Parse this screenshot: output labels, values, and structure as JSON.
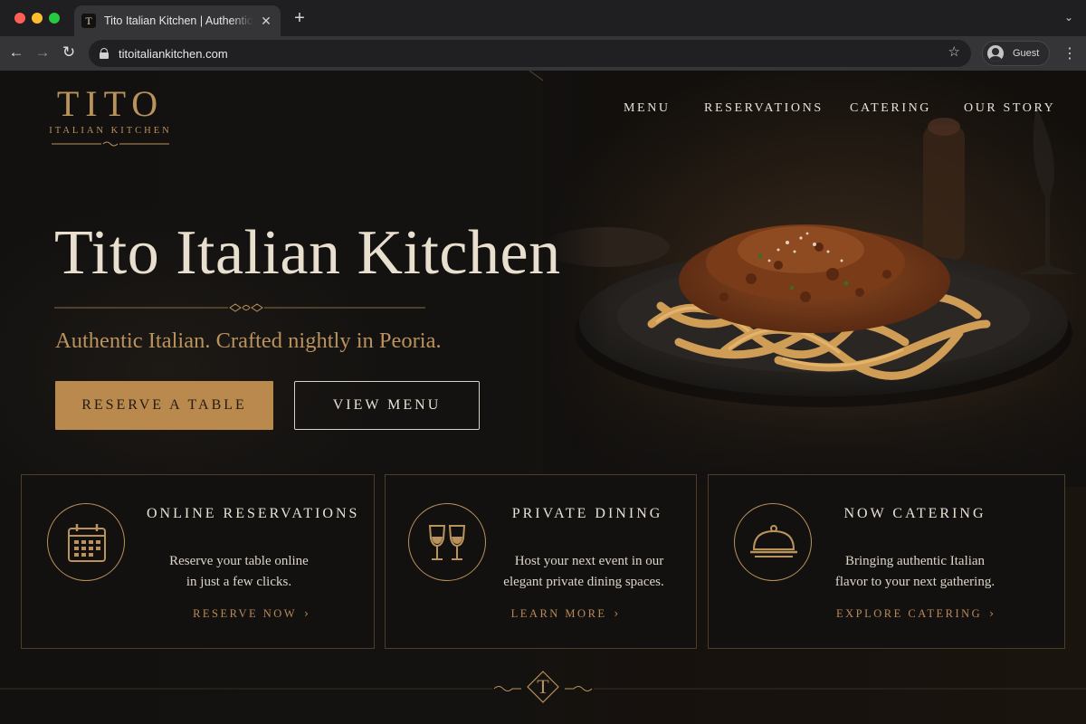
{
  "browser": {
    "tab_title": "Tito Italian Kitchen | Authentic Italian",
    "favicon_letter": "T",
    "url": "titoitaliankitchen.com",
    "profile_label": "Guest"
  },
  "brand": {
    "name": "TITO",
    "subtitle": "ITALIAN KITCHEN"
  },
  "nav": [
    "MENU",
    "RESERVATIONS",
    "CATERING",
    "OUR STORY"
  ],
  "hero": {
    "title": "Tito Italian Kitchen",
    "tagline": "Authentic Italian. Crafted nightly in Peoria.",
    "primary_button": "RESERVE A TABLE",
    "secondary_button": "VIEW MENU"
  },
  "cards": [
    {
      "icon": "calendar-icon",
      "title": "ONLINE RESERVATIONS",
      "text_line1": "Reserve your table online",
      "text_line2": "in just a few clicks.",
      "link": "RESERVE NOW"
    },
    {
      "icon": "wine-glasses-icon",
      "title": "PRIVATE DINING",
      "text_line1": "Host your next event in our",
      "text_line2": "elegant private dining spaces.",
      "link": "LEARN MORE"
    },
    {
      "icon": "cloche-icon",
      "title": "NOW CATERING",
      "text_line1": "Bringing authentic Italian",
      "text_line2": "flavor to your next gathering.",
      "link": "EXPLORE CATERING"
    }
  ],
  "footer": {
    "monogram": "T"
  },
  "colors": {
    "accent_gold": "#b9925c",
    "button_gold": "#b9894e",
    "background": "#121110",
    "text_cream": "#e9dfcf"
  }
}
